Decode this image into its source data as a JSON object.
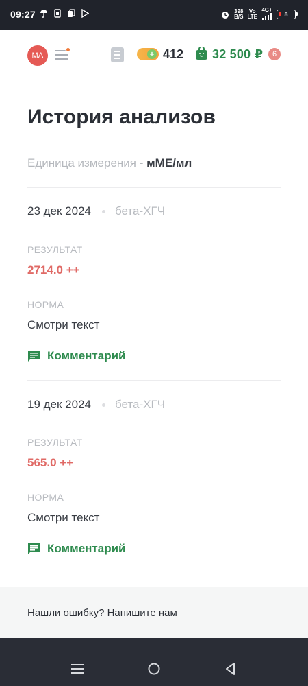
{
  "status": {
    "time": "09:27",
    "speed_top": "398",
    "speed_bottom": "B/S",
    "net_top": "Vo",
    "net_bottom": "LTE",
    "signal": "4G+",
    "battery": "8"
  },
  "header": {
    "avatar_initials": "MA",
    "coins": "412",
    "balance": "32 500 ₽",
    "cart_count": "6",
    "accent": "#2e8b4e",
    "avatar_color": "#e55a55"
  },
  "page": {
    "title": "История анализов",
    "unit_label": "Единица измерения - ",
    "unit_value": "мМЕ/мл"
  },
  "records": [
    {
      "date": "23 дек 2024",
      "test": "бета-ХГЧ",
      "result_label": "РЕЗУЛЬТАТ",
      "result": "2714.0 ++",
      "norm_label": "НОРМА",
      "norm": "Смотри текст",
      "comment": "Комментарий"
    },
    {
      "date": "19 дек 2024",
      "test": "бета-ХГЧ",
      "result_label": "РЕЗУЛЬТАТ",
      "result": "565.0 ++",
      "norm_label": "НОРМА",
      "norm": "Смотри текст",
      "comment": "Комментарий"
    }
  ],
  "footer": {
    "text": "Нашли ошибку? Напишите нам"
  },
  "icons": {
    "menu": "hamburger-icon",
    "list": "list-icon",
    "coins": "coin-plus-icon",
    "bag": "shopping-bag-icon",
    "comment": "comment-icon",
    "nav_recent": "recent-apps-icon",
    "nav_home": "home-icon",
    "nav_back": "back-icon"
  }
}
